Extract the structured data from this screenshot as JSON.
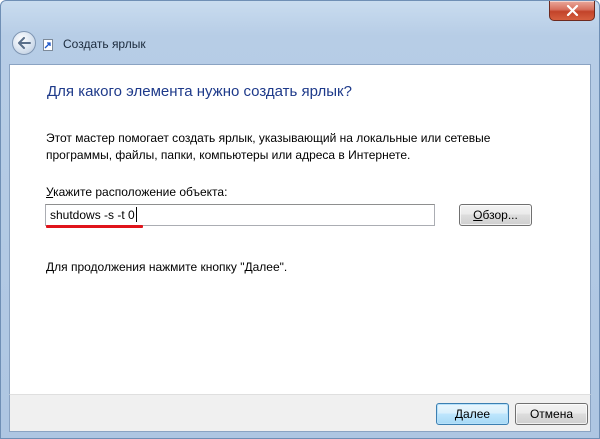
{
  "window": {
    "nav_title": "Создать ярлык"
  },
  "main": {
    "heading": "Для какого элемента нужно создать ярлык?",
    "description": "Этот мастер помогает создать ярлык, указывающий на локальные или сетевые программы, файлы, папки, компьютеры или адреса в Интернете.",
    "field_label_accesskey": "У",
    "field_label_rest": "кажите расположение объекта:",
    "path_value": "shutdows -s -t 0",
    "browse_accesskey": "О",
    "browse_rest": "бзор...",
    "hint": "Для продолжения нажмите кнопку \"Далее\"."
  },
  "footer": {
    "next_label": "Далее",
    "cancel_label": "Отмена"
  },
  "colors": {
    "heading": "#1e3a8a",
    "annotation_underline": "#e0141b",
    "frame": "#b7cde6"
  },
  "icons": {
    "close": "close-icon",
    "back": "back-arrow-icon",
    "shortcut": "shortcut-icon"
  }
}
